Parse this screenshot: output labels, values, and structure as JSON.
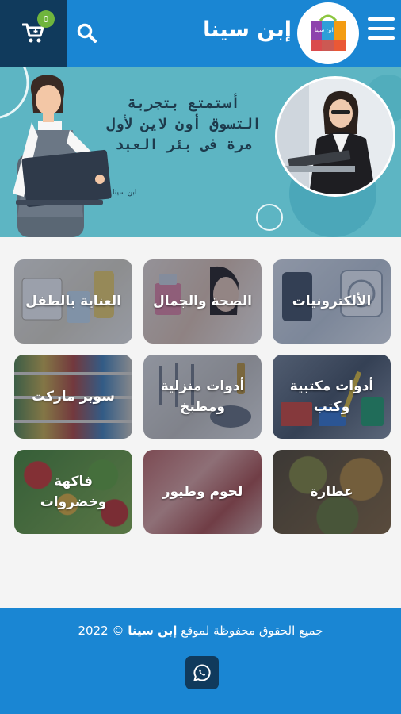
{
  "header": {
    "site_title": "إبن سينا",
    "cart_count": "0",
    "logo_text": "ابن سينا",
    "cart_icon": "shopping-cart-icon",
    "search_icon": "search-icon",
    "menu_icon": "hamburger-menu-icon"
  },
  "banner": {
    "headline_lines": [
      "أستمتع بتجربة",
      "التسوق أون لاين لأول",
      "مرة فى بئر العبد"
    ],
    "signature": "ابن سينا"
  },
  "categories": [
    {
      "label": "الألكترونيات"
    },
    {
      "label": "الصحة والجمال"
    },
    {
      "label": "العناية بالطفل"
    },
    {
      "label": "أدوات مكتبية وكتب"
    },
    {
      "label": "أدوات منزلية ومطبخ"
    },
    {
      "label": "سوبر ماركت"
    },
    {
      "label": "عطارة"
    },
    {
      "label": "لحوم وطيور"
    },
    {
      "label": "فاكهة وخضروات"
    }
  ],
  "footer": {
    "copyright_prefix": "جميع الحقوق محفوظة لموقع",
    "copyright_brand": "إبن سينا",
    "copyright_suffix": "© 2022",
    "whatsapp_icon": "whatsapp-icon"
  },
  "colors": {
    "header_blue": "#1a86d3",
    "dark_navy": "#103a5c",
    "badge_green": "#6fb53d",
    "banner_teal": "#5db5c3"
  }
}
